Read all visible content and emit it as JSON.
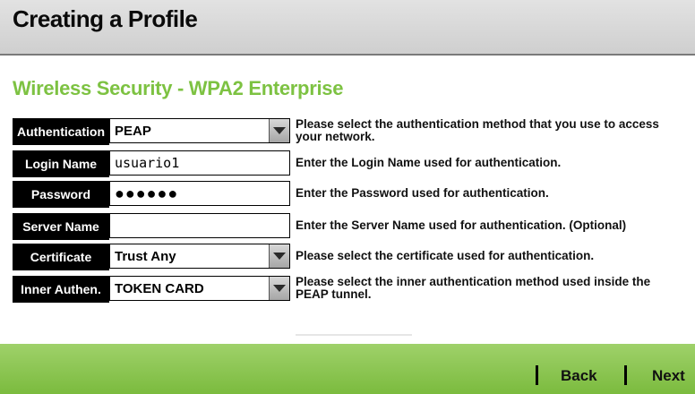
{
  "header": {
    "title": "Creating a Profile"
  },
  "section": {
    "title": "Wireless Security - WPA2 Enterprise"
  },
  "rows": [
    {
      "label": "Authentication",
      "value": "PEAP",
      "help": "Please select the authentication method that you use to access your network."
    },
    {
      "label": "Login Name",
      "value": "usuario1",
      "help": "Enter the Login Name used for authentication."
    },
    {
      "label": "Password",
      "value": "●●●●●●",
      "help": "Enter the Password used for authentication."
    },
    {
      "label": "Server Name",
      "value": "",
      "help": "Enter the Server Name used for authentication.",
      "help_optional": "(Optional)"
    },
    {
      "label": "Certificate",
      "value": "Trust Any",
      "help": "Please select the certificate used for authentication."
    },
    {
      "label": "Inner Authen.",
      "value": "TOKEN CARD",
      "help": "Please select the inner authentication method used inside the PEAP tunnel."
    }
  ],
  "footer": {
    "back_label": "Back",
    "next_label": "Next"
  },
  "colors": {
    "accent_green": "#7dc242",
    "footer_green": "#8cc651",
    "label_bg": "#000000"
  }
}
